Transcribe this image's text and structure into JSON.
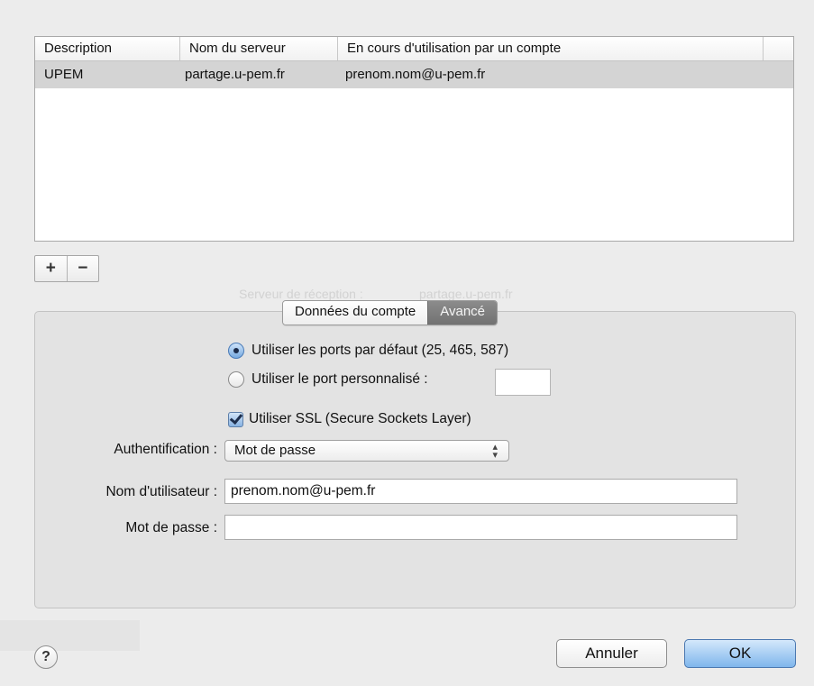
{
  "table": {
    "headers": [
      "Description",
      "Nom du serveur",
      "En cours d'utilisation par un compte"
    ],
    "rows": [
      [
        "UPEM",
        "partage.u-pem.fr",
        "prenom.nom@u-pem.fr"
      ]
    ]
  },
  "list_controls": {
    "add": "+",
    "remove": "−"
  },
  "tabs": [
    {
      "label": "Données du compte",
      "active": false
    },
    {
      "label": "Avancé",
      "active": true
    }
  ],
  "ports": {
    "default_option": "Utiliser les ports par défaut (25, 465, 587)",
    "custom_option": "Utiliser le port personnalisé :",
    "custom_value": "",
    "selected": "default"
  },
  "ssl": {
    "label": "Utiliser SSL (Secure Sockets Layer)",
    "checked": true
  },
  "auth": {
    "label": "Authentification :",
    "value": "Mot de passe"
  },
  "username": {
    "label": "Nom d'utilisateur :",
    "value": "prenom.nom@u-pem.fr"
  },
  "password": {
    "label": "Mot de passe :",
    "value": ""
  },
  "buttons": {
    "help": "?",
    "cancel": "Annuler",
    "ok": "OK"
  }
}
